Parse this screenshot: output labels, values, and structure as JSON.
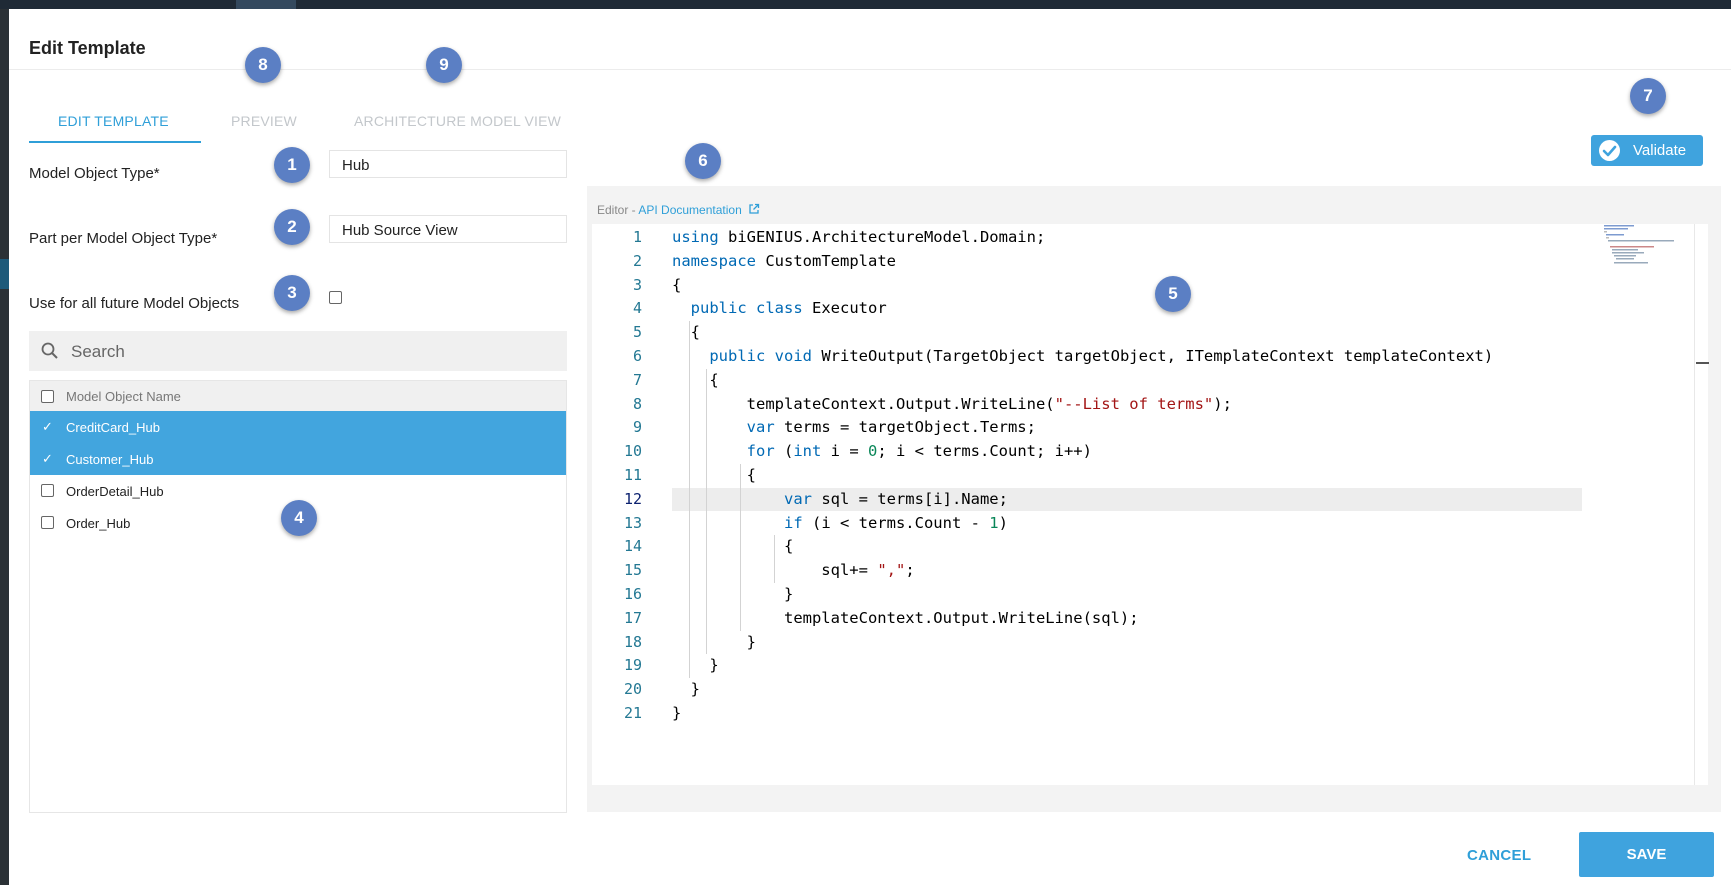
{
  "dialog": {
    "title": "Edit Template"
  },
  "tabs": [
    {
      "label": "EDIT TEMPLATE",
      "active": true
    },
    {
      "label": "PREVIEW",
      "active": false
    },
    {
      "label": "ARCHITECTURE MODEL VIEW",
      "active": false
    }
  ],
  "form": {
    "model_object_type_label": "Model Object Type*",
    "model_object_type_value": "Hub",
    "part_label": "Part per Model Object Type*",
    "part_value": "Hub Source View",
    "future_label": "Use for all future Model Objects",
    "future_checked": false
  },
  "search": {
    "placeholder": "Search"
  },
  "list": {
    "header": "Model Object Name",
    "items": [
      {
        "name": "CreditCard_Hub",
        "selected": true
      },
      {
        "name": "Customer_Hub",
        "selected": true
      },
      {
        "name": "OrderDetail_Hub",
        "selected": false
      },
      {
        "name": "Order_Hub",
        "selected": false
      }
    ]
  },
  "validate": {
    "label": "Validate"
  },
  "editor": {
    "caption_prefix": "Editor - ",
    "api_link": "API Documentation",
    "current_line": 12,
    "lines": [
      "using biGENIUS.ArchitectureModel.Domain;",
      "namespace CustomTemplate",
      "{",
      "  public class Executor",
      "  {",
      "    public void WriteOutput(TargetObject targetObject, ITemplateContext templateContext)",
      "    {",
      "        templateContext.Output.WriteLine(\"--List of terms\");",
      "        var terms = targetObject.Terms;",
      "        for (int i = 0; i < terms.Count; i++)",
      "        {",
      "            var sql = terms[i].Name;",
      "            if (i < terms.Count - 1)",
      "            {",
      "                sql+= \",\";",
      "            }",
      "            templateContext.Output.WriteLine(sql);",
      "        }",
      "    }",
      "  }",
      "}"
    ]
  },
  "badges": [
    "1",
    "2",
    "3",
    "4",
    "5",
    "6",
    "7",
    "8",
    "9"
  ],
  "footer": {
    "cancel_label": "CANCEL",
    "save_label": "SAVE"
  },
  "colors": {
    "accent": "#2f9fd8",
    "selected_row": "#42a5de",
    "badge": "#5b7fc4"
  },
  "icons": [
    "search-icon",
    "check-icon",
    "external-link-icon",
    "validate-check-icon"
  ]
}
